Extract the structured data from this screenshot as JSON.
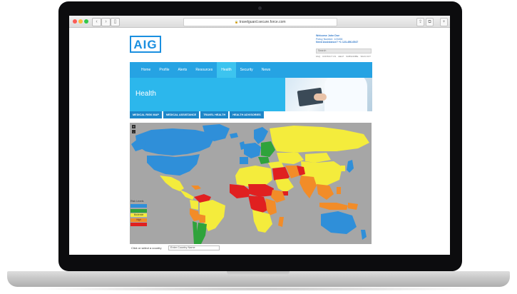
{
  "browser": {
    "url": "travelguard.secure.force.com"
  },
  "site": {
    "logo_text": "AIG",
    "account": {
      "welcome": "Welcome John Doe",
      "policy": "Policy Number: 123456",
      "assistance": "Need Assistance?",
      "phone": "+1 123-456-6547"
    },
    "search_placeholder": "Search",
    "mini_links": [
      "FAQ",
      "CONTACT US",
      "HELP",
      "SUBSCRIBE",
      "SIGN OUT"
    ],
    "nav": [
      {
        "label": "Home"
      },
      {
        "label": "Profile"
      },
      {
        "label": "Alerts"
      },
      {
        "label": "Resources"
      },
      {
        "label": "Health"
      },
      {
        "label": "Security"
      },
      {
        "label": "News"
      }
    ],
    "active_nav": "Health",
    "hero_title": "Health",
    "subtabs": [
      "MEDICAL RISK MAP",
      "MEDICAL ASSISTANCE",
      "TRAVEL HEALTH",
      "HEALTH ADVISORIES"
    ],
    "map": {
      "zoom_in": "+",
      "zoom_out": "-",
      "legend_title": "Risk Levels",
      "legend": [
        {
          "label": "",
          "color": "#2f8fd9"
        },
        {
          "label": "",
          "color": "#2fa33b"
        },
        {
          "label": "Moderate",
          "color": "#f4ec3c"
        },
        {
          "label": "High",
          "color": "#f28c28"
        },
        {
          "label": "",
          "color": "#e02020"
        }
      ],
      "ocean_color": "#a6a6a6"
    },
    "lookup": {
      "label": "Click or select a country",
      "placeholder": "Enter Country Name"
    }
  }
}
